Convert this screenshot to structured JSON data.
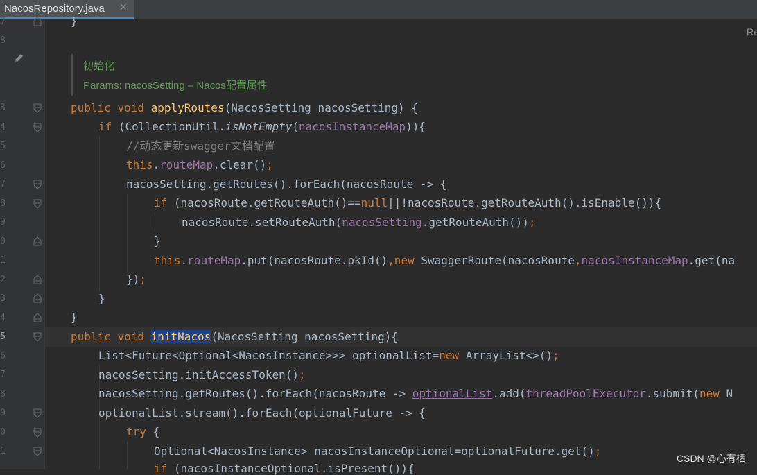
{
  "tab": {
    "label": "NacosRepository.java",
    "close_glyph": "✕"
  },
  "reader_mode_label": "Re",
  "line_numbers": [
    "7",
    "8",
    "",
    "3",
    "4",
    "5",
    "6",
    "7",
    "8",
    "9",
    "0",
    "1",
    "2",
    "3",
    "4",
    "5",
    "6",
    "7",
    "8",
    "9",
    "0",
    "1"
  ],
  "current_line_number": "5",
  "doc_comment": {
    "line1": "初始化",
    "line2": "Params: nacosSetting – Nacos配置属性"
  },
  "code": {
    "l0": "}",
    "l1_kw1": "public",
    "l1_kw2": "void",
    "l1_fn": "applyRoutes",
    "l1_rest": "(NacosSetting nacosSetting) {",
    "l2_kw": "if",
    "l2_a": " (CollectionUtil.",
    "l2_method": "isNotEmpty",
    "l2_b": "(",
    "l2_field": "nacosInstanceMap",
    "l2_c": ")){",
    "l3_comment": "//动态更新swagger文档配置",
    "l4_kw": "this",
    "l4_dot": ".",
    "l4_field": "routeMap",
    "l4_rest": ".clear()",
    "l4_semi": ";",
    "l5": "nacosSetting.getRoutes().forEach(nacosRoute -> {",
    "l6_kw": "if",
    "l6_a": " (nacosRoute.getRouteAuth()==",
    "l6_null": "null",
    "l6_b": "||!nacosRoute.getRouteAuth().isEnable()){",
    "l7_a": "nacosRoute.setRouteAuth(",
    "l7_field": "nacosSetting",
    "l7_b": ".getRouteAuth())",
    "l7_semi": ";",
    "l8": "}",
    "l9_kw": "this",
    "l9_dot": ".",
    "l9_field": "routeMap",
    "l9_a": ".put(nacosRoute.pkId()",
    "l9_comma": ",",
    "l9_new": "new",
    "l9_b": " SwaggerRoute(nacosRoute",
    "l9_comma2": ",",
    "l9_field2": "nacosInstanceMap",
    "l9_c": ".get(na",
    "l10_a": "})",
    "l10_semi": ";",
    "l11": "}",
    "l12": "}",
    "l13_kw1": "public",
    "l13_kw2": "void",
    "l13_fn": "initNacos",
    "l13_rest": "(NacosSetting nacosSetting){",
    "l14_a": "List<Future<Optional<NacosInstance>>> optionalList=",
    "l14_new": "new",
    "l14_b": " ArrayList<>()",
    "l14_semi": ";",
    "l15_a": "nacosSetting.initAccessToken()",
    "l15_semi": ";",
    "l16_a": "nacosSetting.getRoutes().forEach(nacosRoute -> ",
    "l16_field": "optionalList",
    "l16_b": ".add(",
    "l16_field2": "threadPoolExecutor",
    "l16_c": ".submit(",
    "l16_new": "new",
    "l16_d": " N",
    "l17": "optionalList.stream().forEach(optionalFuture -> {",
    "l18_kw": "try",
    "l18_rest": " {",
    "l19_a": "Optional<NacosInstance> nacosInstanceOptional=optionalFuture.get()",
    "l19_semi": ";",
    "l20_kw": "if",
    "l20_rest": " (nacosInstanceOptional.isPresent()){"
  },
  "watermark": "CSDN @心有栖"
}
